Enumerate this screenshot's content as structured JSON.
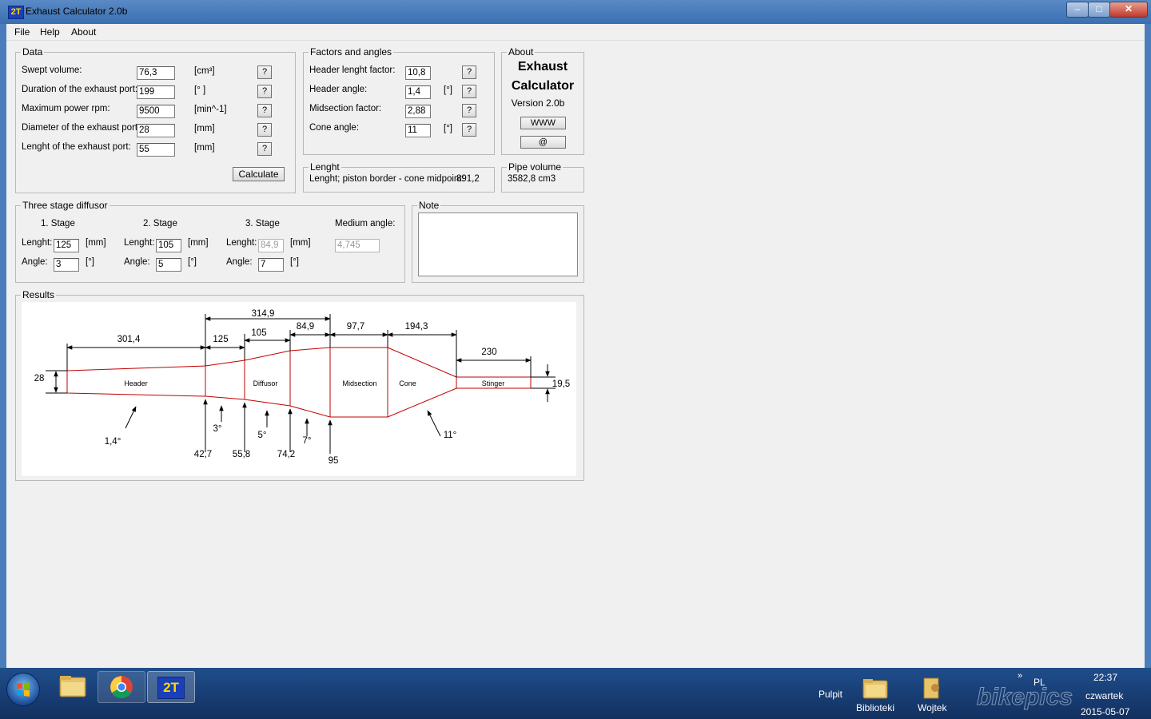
{
  "window": {
    "title": "Exhaust Calculator 2.0b",
    "icon_text": "2T",
    "min_glyph": "–",
    "max_glyph": "□",
    "close_glyph": "✕"
  },
  "menu": [
    "File",
    "Help",
    "About"
  ],
  "data_group": {
    "label": "Data",
    "rows": [
      {
        "label": "Swept volume:",
        "value": "76,3",
        "unit": "[cm³]",
        "help": "?"
      },
      {
        "label": "Duration of the exhaust port:",
        "value": "199",
        "unit": "[° ]",
        "help": "?"
      },
      {
        "label": "Maximum power rpm:",
        "value": "9500",
        "unit": "[min^-1]",
        "help": "?"
      },
      {
        "label": "Diameter of the exhaust port:",
        "value": "28",
        "unit": "[mm]",
        "help": "?"
      },
      {
        "label": "Lenght of the exhaust port:",
        "value": "55",
        "unit": "[mm]",
        "help": "?"
      }
    ],
    "calculate": "Calculate"
  },
  "factors_group": {
    "label": "Factors and angles",
    "rows": [
      {
        "label": "Header lenght factor:",
        "value": "10,8",
        "unit": "",
        "help": "?"
      },
      {
        "label": "Header angle:",
        "value": "1,4",
        "unit": "[°]",
        "help": "?"
      },
      {
        "label": "Midsection factor:",
        "value": "2,88",
        "unit": "",
        "help": "?"
      },
      {
        "label": "Cone angle:",
        "value": "11",
        "unit": "[°]",
        "help": "?"
      }
    ]
  },
  "about_group": {
    "label": "About",
    "line1": "Exhaust",
    "line2": "Calculator",
    "version": "Version 2.0b",
    "www": "WWW",
    "at": "@"
  },
  "length_group": {
    "label": "Lenght",
    "text": "Lenght; piston border - cone midpoint:",
    "value": "891,2"
  },
  "pipe_group": {
    "label": "Pipe volume",
    "value": "3582,8 cm3"
  },
  "diffusor_group": {
    "label": "Three stage diffusor",
    "stages": [
      {
        "title": "1. Stage",
        "len_label": "Lenght:",
        "length": "125",
        "len_unit": "[mm]",
        "ang_label": "Angle:",
        "angle": "3",
        "ang_unit": "[°]"
      },
      {
        "title": "2. Stage",
        "len_label": "Lenght:",
        "length": "105",
        "len_unit": "[mm]",
        "ang_label": "Angle:",
        "angle": "5",
        "ang_unit": "[°]"
      },
      {
        "title": "3. Stage",
        "len_label": "Lenght:",
        "length": "84,9",
        "len_unit": "[mm]",
        "ang_label": "Angle:",
        "angle": "7",
        "ang_unit": "[°]"
      }
    ],
    "medium_label": "Medium angle:",
    "medium_value": "4,745"
  },
  "note_group": {
    "label": "Note",
    "value": ""
  },
  "results": {
    "label": "Results",
    "sections": [
      "Header",
      "Diffusor",
      "Midsection",
      "Cone",
      "Stinger"
    ],
    "dims": [
      "314,9",
      "84,9",
      "97,7",
      "194,3",
      "105",
      "301,4",
      "125",
      "230"
    ],
    "diameter_in": "28",
    "diameter_out": "19,5",
    "angles": [
      "1,4°",
      "3°",
      "5°",
      "7°",
      "11°"
    ],
    "diameters": [
      "42,7",
      "55,8",
      "74,2",
      "95"
    ]
  },
  "taskbar": {
    "pulpit": "Pulpit",
    "biblioteki": "Biblioteki",
    "wojtek": "Wojtek",
    "lang": "PL",
    "time": "22:37",
    "day": "czwartek",
    "date": "2015-05-07",
    "app_label": "2T",
    "arrows": "»",
    "watermark": "bikepics"
  }
}
